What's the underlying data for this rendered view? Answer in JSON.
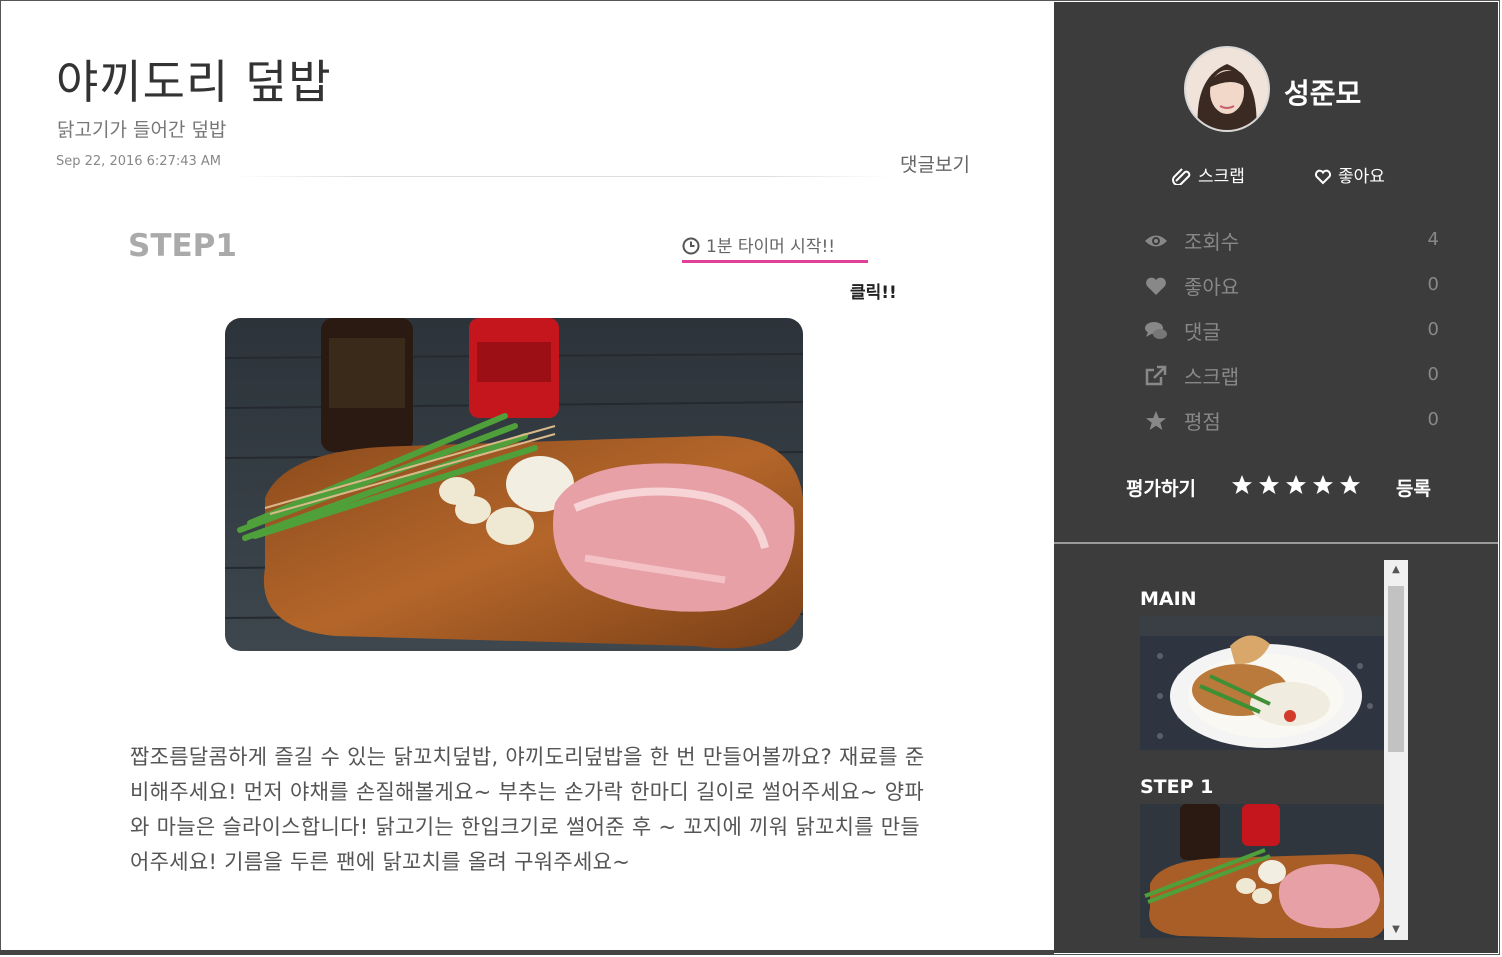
{
  "recipe": {
    "title": "야끼도리 덮밥",
    "subtitle": "닭고기가 들어간 덮밥",
    "date": "Sep 22, 2016 6:27:43 AM",
    "comment_link": "댓글보기"
  },
  "step": {
    "label": "STEP1",
    "timer_label": "1분 타이머 시작!!",
    "click_note": "클릭!!",
    "description": "짭조름달콤하게 즐길 수 있는 닭꼬치덮밥, 야끼도리덮밥을 한 번 만들어볼까요? 재료를 준비해주세요! 먼저 야채를 손질해볼게요~ 부추는 손가락 한마디 길이로 썰어주세요~ 양파와 마늘은 슬라이스합니다! 닭고기는 한입크기로 썰어준 후 ~ 꼬지에 끼워 닭꼬치를 만들어주세요! 기름을 두른 팬에 닭꼬치를 올려 구워주세요~"
  },
  "sidebar": {
    "author": "성준모",
    "scrap_label": "스크랩",
    "like_label": "좋아요",
    "stats": [
      {
        "icon": "eye-icon",
        "label": "조회수",
        "value": "4"
      },
      {
        "icon": "heart-icon",
        "label": "좋아요",
        "value": "0"
      },
      {
        "icon": "comments-icon",
        "label": "댓글",
        "value": "0"
      },
      {
        "icon": "external-link-icon",
        "label": "스크랩",
        "value": "0"
      },
      {
        "icon": "star-icon",
        "label": "평점",
        "value": "0"
      }
    ],
    "rate_label": "평가하기",
    "star_count": 5,
    "register_label": "등록",
    "thumbnails": [
      {
        "label": "MAIN"
      },
      {
        "label": "STEP 1"
      }
    ]
  },
  "colors": {
    "sidebar_bg": "#3c3c3c",
    "timer_underline": "#e0409a",
    "text_muted": "#888888"
  }
}
